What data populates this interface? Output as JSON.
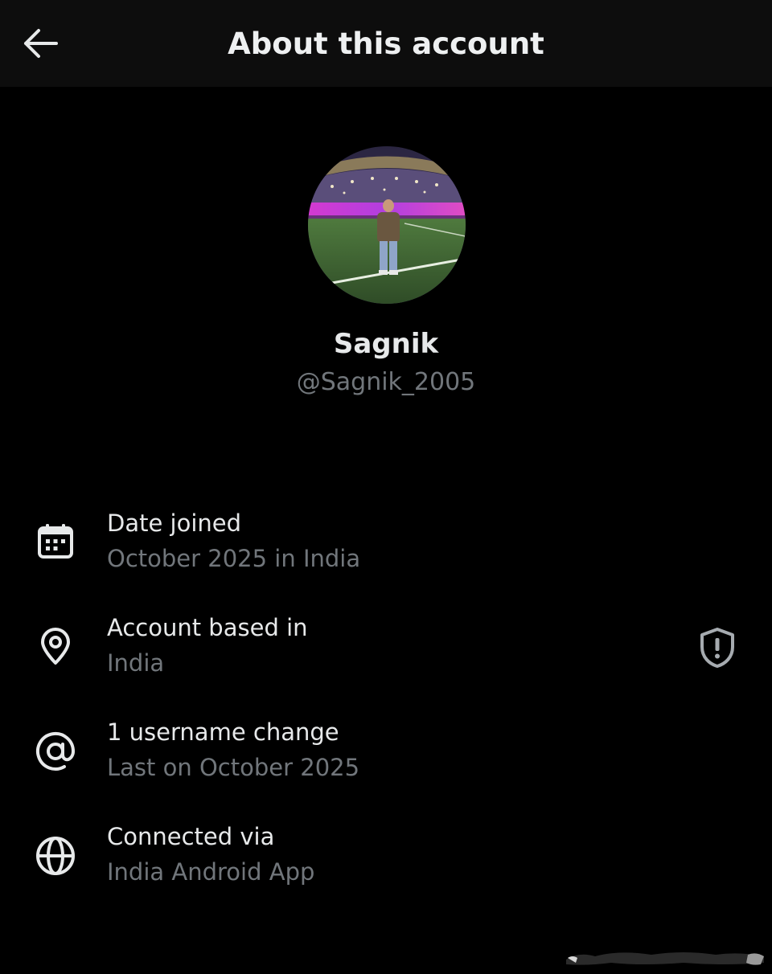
{
  "header": {
    "title": "About this account",
    "back_icon": "arrow-left-icon"
  },
  "profile": {
    "display_name": "Sagnik",
    "handle": "@Sagnik_2005",
    "avatar_icon": "profile-photo-stadium"
  },
  "details": [
    {
      "icon": "calendar-icon",
      "title": "Date joined",
      "subtitle": "October 2025 in India"
    },
    {
      "icon": "location-pin-icon",
      "title": "Account based in",
      "subtitle": "India"
    },
    {
      "icon": "at-sign-icon",
      "title": "1 username change",
      "subtitle": "Last on October 2025"
    },
    {
      "icon": "globe-icon",
      "title": "Connected via",
      "subtitle": "India Android App"
    }
  ],
  "shield_icon": "shield-alert-icon",
  "colors": {
    "background": "#000000",
    "header_bg": "#0d0d0d",
    "primary_text": "#e7e9ea",
    "secondary_text": "#71767b",
    "icon": "#e7e9ea"
  }
}
